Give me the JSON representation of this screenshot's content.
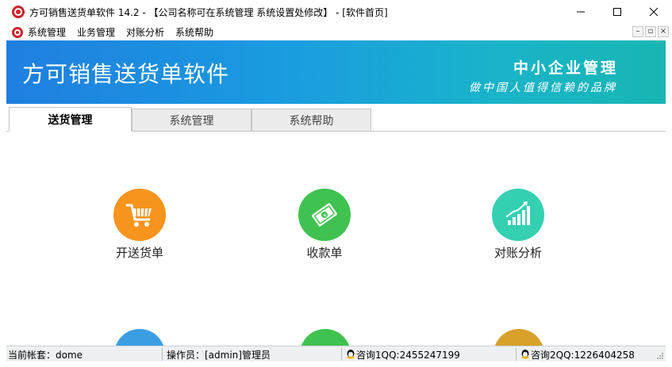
{
  "window": {
    "title": "方可销售送货单软件 14.2 - 【公司名称可在系统管理 系统设置处修改】 - [软件首页]",
    "buttons": {
      "minimize": "minimize-icon",
      "maximize": "maximize-icon",
      "close": "close-icon"
    }
  },
  "menu": {
    "items": [
      "系统管理",
      "业务管理",
      "对账分析",
      "系统帮助"
    ],
    "mdi": [
      "–",
      "▫",
      "×"
    ]
  },
  "banner": {
    "title": "方可销售送货单软件",
    "slogan_line1": "中小企业管理",
    "slogan_line2": "做中国人值得信赖的品牌",
    "colors": {
      "start": "#1f7fe0",
      "end": "#17b6b2"
    }
  },
  "tabs": [
    {
      "label": "送货管理",
      "active": true
    },
    {
      "label": "系统管理",
      "active": false
    },
    {
      "label": "系统帮助",
      "active": false
    }
  ],
  "functions": [
    {
      "label": "开送货单",
      "icon": "shopping-cart-icon",
      "color": "#f7941d"
    },
    {
      "label": "收款单",
      "icon": "money-icon",
      "color": "#3fc24f"
    },
    {
      "label": "对账分析",
      "icon": "bar-chart-icon",
      "color": "#35cfb1"
    }
  ],
  "partial_functions": [
    {
      "icon": "partial-icon-1",
      "color": "#3b9ee3"
    },
    {
      "icon": "partial-icon-2",
      "color": "#3fc24f"
    },
    {
      "icon": "partial-icon-3",
      "color": "#d8a12a"
    }
  ],
  "status": {
    "account": "当前帐套：dome",
    "operator": "操作员：[admin]管理员",
    "qq1": "咨询1QQ:2455247199",
    "qq2": "咨询2QQ:1226404258"
  }
}
